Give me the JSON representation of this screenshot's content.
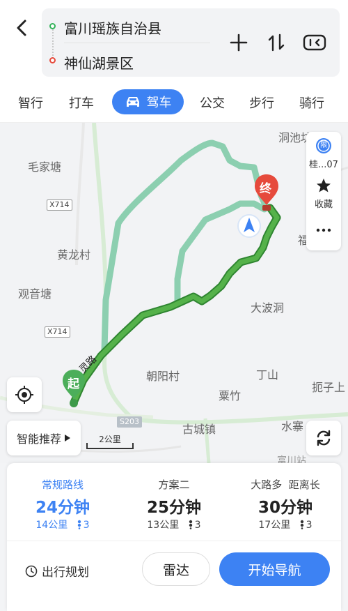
{
  "header": {
    "origin": "富川瑶族自治县",
    "destination": "神仙湖景区"
  },
  "tabs": [
    {
      "label": "智行"
    },
    {
      "label": "打车"
    },
    {
      "label": "驾车",
      "active": true
    },
    {
      "label": "公交"
    },
    {
      "label": "步行"
    },
    {
      "label": "骑行"
    }
  ],
  "map": {
    "places": {
      "maojiatang": "毛家塘",
      "huanglongcun": "黄龙村",
      "guanyintang": "观音塘",
      "dabodong": "大波洞",
      "chaoyangcun": "朝阳村",
      "dingshan": "丁山",
      "suzhu": "粟竹",
      "gucheng": "古城镇",
      "shuizhai": "水寨",
      "yuzi": "扼子上",
      "dongchi": "洞池坊",
      "fu": "福",
      "fuchuan_station": "富川站"
    },
    "roads": {
      "x714_a": "X714",
      "x714_b": "X714",
      "s203": "S203",
      "road_label": "灵路"
    },
    "markers": {
      "start": "起",
      "end": "终"
    },
    "scale": "2公里",
    "side": {
      "restrict_label": "桂...07",
      "restrict_badge": "限",
      "favorite_label": "收藏"
    },
    "smart_label": "智能推荐"
  },
  "options": [
    {
      "title": "常规路线",
      "time": "24分钟",
      "distance": "14公里",
      "lights": "3",
      "active": true
    },
    {
      "title": "方案二",
      "time": "25分钟",
      "distance": "13公里",
      "lights": "3"
    },
    {
      "title": "大路多  距离长",
      "time": "30分钟",
      "distance": "17公里",
      "lights": "3"
    }
  ],
  "actions": {
    "plan": "出行规划",
    "radar": "雷达",
    "navigate": "开始导航"
  },
  "colors": {
    "accent": "#3d82f3",
    "route_main": "#3a9c3c",
    "route_alt": "#8ccfb0",
    "end_marker": "#e64a3c",
    "start_marker": "#4cae5a"
  }
}
